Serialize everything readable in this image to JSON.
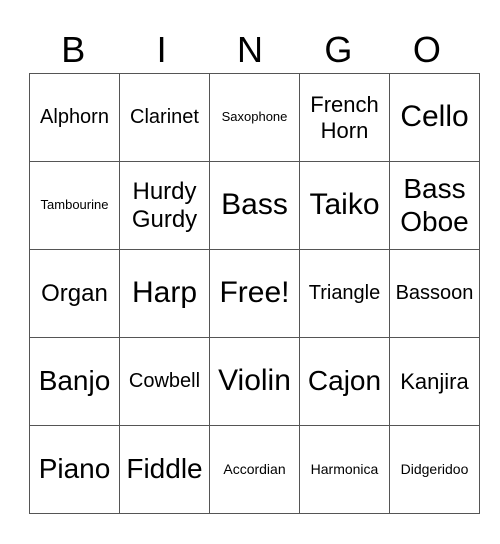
{
  "header": {
    "letters": [
      "B",
      "I",
      "N",
      "G",
      "O"
    ]
  },
  "card": {
    "rows": [
      [
        "Alphorn",
        "Clarinet",
        "Saxophone",
        "French Horn",
        "Cello"
      ],
      [
        "Tambourine",
        "Hurdy Gurdy",
        "Bass",
        "Taiko",
        "Bass Oboe"
      ],
      [
        "Organ",
        "Harp",
        "Free!",
        "Triangle",
        "Bassoon"
      ],
      [
        "Banjo",
        "Cowbell",
        "Violin",
        "Cajon",
        "Kanjira"
      ],
      [
        "Piano",
        "Fiddle",
        "Accordian",
        "Harmonica",
        "Didgeridoo"
      ]
    ]
  }
}
